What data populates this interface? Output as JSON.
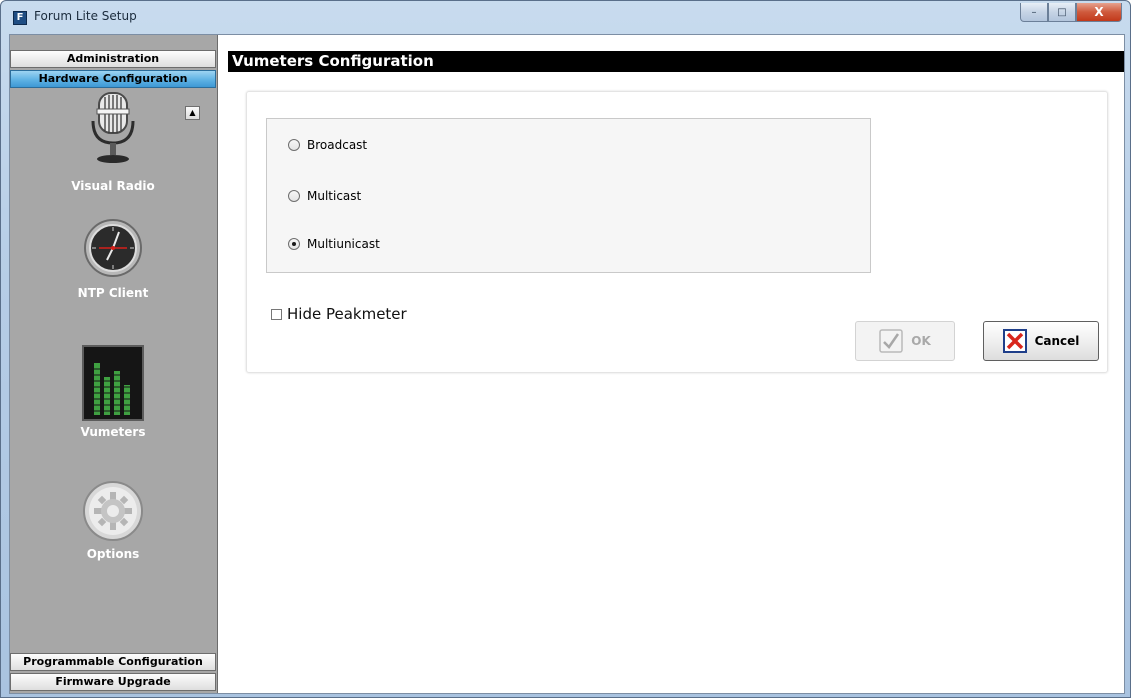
{
  "window": {
    "title": "Forum Lite Setup",
    "app_icon_letter": "F",
    "controls": {
      "minimize": "–",
      "maximize": "□",
      "close": "X"
    }
  },
  "nav": {
    "top_tabs": [
      {
        "label": "Administration"
      },
      {
        "label": "Hardware Configuration"
      }
    ],
    "active_tab": "Hardware Configuration",
    "items": [
      {
        "label": "Visual Radio",
        "icon": "microphone-icon"
      },
      {
        "label": "NTP Client",
        "icon": "clock-icon"
      },
      {
        "label": "Vumeters",
        "icon": "vumeter-icon"
      },
      {
        "label": "Options",
        "icon": "gear-icon"
      }
    ],
    "bottom_tabs": [
      {
        "label": "Programmable Configuration"
      },
      {
        "label": "Firmware Upgrade"
      }
    ],
    "scroll_up": "▲"
  },
  "main": {
    "title": "Vumeters Configuration",
    "mode_options": [
      {
        "label": "Broadcast",
        "selected": false
      },
      {
        "label": "Multicast",
        "selected": false
      },
      {
        "label": "Multiunicast",
        "selected": true
      }
    ],
    "hide_peakmeter": {
      "label": "Hide Peakmeter",
      "checked": false
    },
    "buttons": {
      "ok": {
        "label": "OK",
        "enabled": false
      },
      "cancel": {
        "label": "Cancel",
        "enabled": true
      }
    }
  },
  "colors": {
    "nav_background": "#a7a7a7",
    "active_tab": "#5fb2e4",
    "title_bar_bg": "#000000",
    "cancel_red": "#d9261c",
    "ok_check_disabled": "#a8a8a8"
  }
}
